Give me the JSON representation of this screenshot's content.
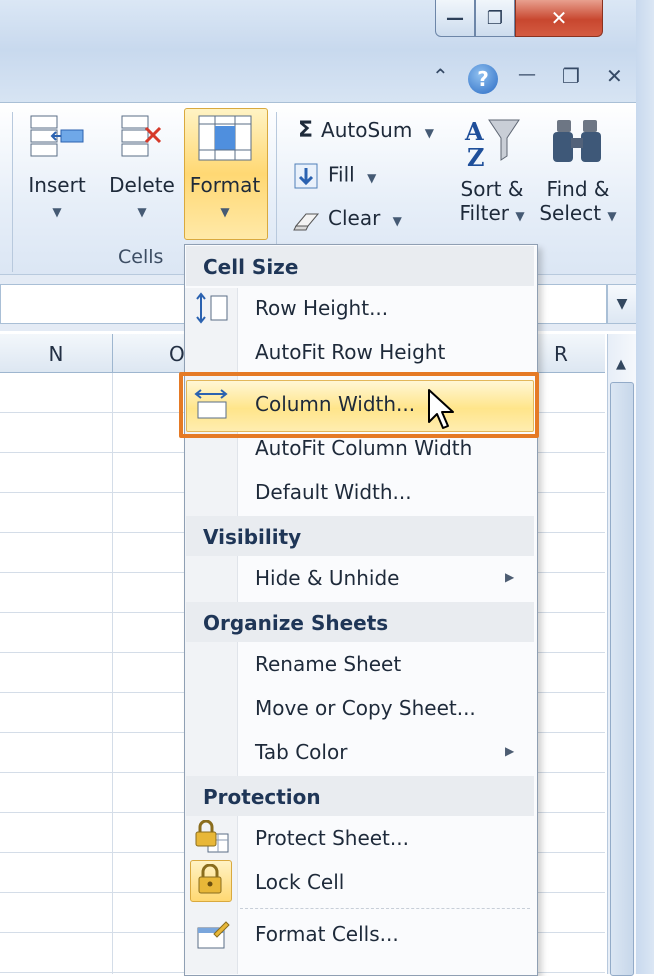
{
  "window": {
    "minimize_glyph": "—",
    "restore_glyph": "❐",
    "close_glyph": "✕"
  },
  "help_row": {
    "collapse_glyph": "⌃",
    "help_glyph": "?",
    "min_glyph": "—",
    "restore_glyph": "❐",
    "close_glyph": "✕"
  },
  "ribbon": {
    "cells_group": {
      "label": "Cells",
      "insert_label": "Insert",
      "delete_label": "Delete",
      "format_label": "Format"
    },
    "editing_group": {
      "autosum_label": "AutoSum",
      "autosum_glyph": "Σ",
      "fill_label": "Fill",
      "clear_label": "Clear",
      "sort_label_1": "Sort &",
      "sort_label_2": "Filter",
      "find_label_1": "Find &",
      "find_label_2": "Select"
    }
  },
  "sheet": {
    "columns": [
      "N",
      "O",
      "R"
    ]
  },
  "menu": {
    "sections": {
      "cell_size": "Cell Size",
      "visibility": "Visibility",
      "organize": "Organize Sheets",
      "protection": "Protection"
    },
    "items": {
      "row_height": "Row Height...",
      "autofit_row": "AutoFit Row Height",
      "column_width": "Column Width...",
      "autofit_column": "AutoFit Column Width",
      "default_width": "Default Width...",
      "hide_unhide": "Hide & Unhide",
      "rename_sheet": "Rename Sheet",
      "move_copy": "Move or Copy Sheet...",
      "tab_color": "Tab Color",
      "protect_sheet": "Protect Sheet...",
      "lock_cell": "Lock Cell",
      "format_cells": "Format Cells..."
    },
    "highlighted_item": "column_width"
  },
  "colors": {
    "highlight": "#ffe58a",
    "callout_border": "#e57a25",
    "ribbon_bg": "#dbe6f4"
  }
}
